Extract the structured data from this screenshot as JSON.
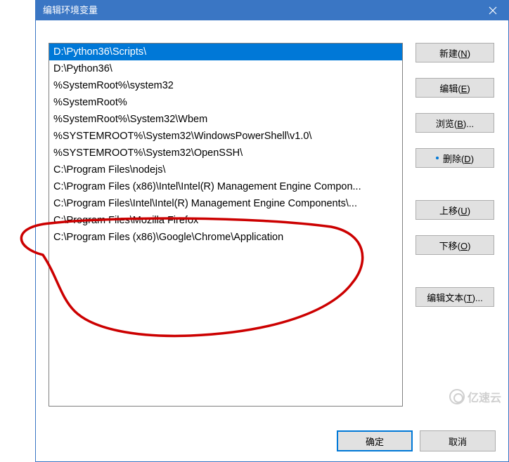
{
  "titlebar": {
    "title": "编辑环境变量"
  },
  "list": {
    "items": [
      "D:\\Python36\\Scripts\\",
      "D:\\Python36\\",
      "%SystemRoot%\\system32",
      "%SystemRoot%",
      "%SystemRoot%\\System32\\Wbem",
      "%SYSTEMROOT%\\System32\\WindowsPowerShell\\v1.0\\",
      "%SYSTEMROOT%\\System32\\OpenSSH\\",
      "C:\\Program Files\\nodejs\\",
      "C:\\Program Files (x86)\\Intel\\Intel(R) Management Engine Compon...",
      "C:\\Program Files\\Intel\\Intel(R) Management Engine Components\\...",
      "C:\\Program Files\\Mozilla Firefox",
      "C:\\Program Files (x86)\\Google\\Chrome\\Application"
    ],
    "selectedIndex": 0
  },
  "buttons": {
    "new": "新建(N)",
    "edit": "编辑(E)",
    "browse": "浏览(B)...",
    "delete": "删除(D)",
    "moveUp": "上移(U)",
    "moveDown": "下移(O)",
    "editText": "编辑文本(T)...",
    "ok": "确定",
    "cancel": "取消"
  },
  "watermark": {
    "text": "亿速云"
  }
}
